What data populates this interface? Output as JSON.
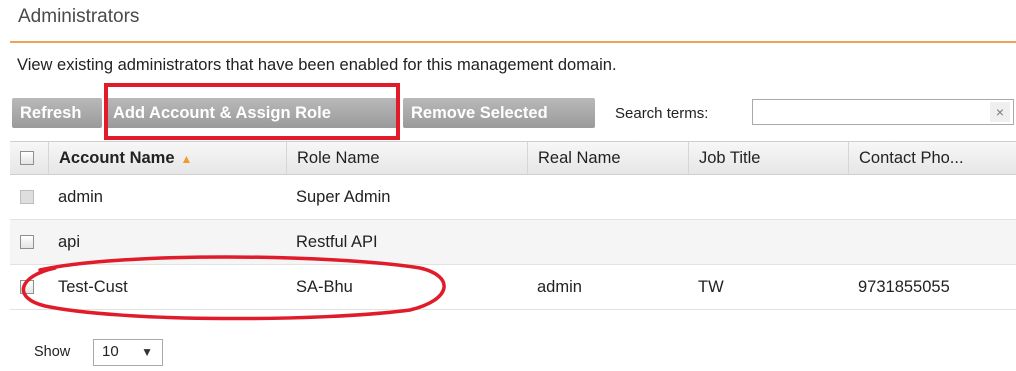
{
  "page": {
    "title": "Administrators",
    "description": "View existing administrators that have been enabled for this management domain."
  },
  "toolbar": {
    "refresh_label": "Refresh",
    "add_label": "Add Account & Assign Role",
    "remove_label": "Remove Selected",
    "search_label": "Search terms:",
    "search_value": "",
    "clear_icon": "×"
  },
  "table": {
    "columns": [
      "Account Name",
      "Role Name",
      "Real Name",
      "Job Title",
      "Contact Pho..."
    ],
    "sort_icon": "▲",
    "rows": [
      {
        "account": "admin",
        "role": "Super Admin",
        "real": "",
        "job": "",
        "phone": ""
      },
      {
        "account": "api",
        "role": "Restful API",
        "real": "",
        "job": "",
        "phone": ""
      },
      {
        "account": "Test-Cust",
        "role": "SA-Bhu",
        "real": "admin",
        "job": "TW",
        "phone": "9731855055"
      }
    ]
  },
  "pager": {
    "show_label": "Show",
    "page_size": "10",
    "dropdown_icon": "▼"
  },
  "colors": {
    "accent": "#f0a25a",
    "annotation": "#e01b2a",
    "button_bg": "#a8a8a8",
    "sort_arrow": "#f39a2c"
  }
}
